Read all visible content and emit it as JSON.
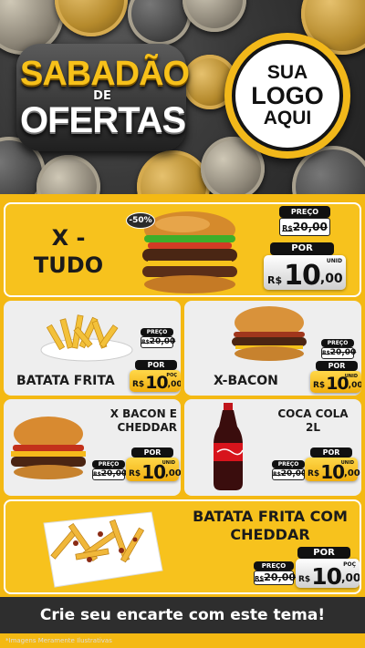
{
  "header": {
    "title_line1": "SABADÃO",
    "title_line2": "DE",
    "title_line3": "OFERTAS",
    "logo_line1": "SUA",
    "logo_line2": "LOGO",
    "logo_line3": "AQUI"
  },
  "featured": {
    "name_line1": "X -",
    "name_line2": "TUDO",
    "discount": "-50%",
    "old_label": "PREÇO",
    "old_currency": "R$",
    "old_price": "20,00",
    "por_label": "POR",
    "currency": "R$",
    "price_int": "10",
    "price_dec": ",00",
    "unit": "UNID"
  },
  "products": [
    {
      "name": "BATATA FRITA",
      "old_label": "PREÇO",
      "old_currency": "R$",
      "old_price": "20,00",
      "por_label": "POR",
      "currency": "R$",
      "price_int": "10",
      "price_dec": ",00",
      "unit": "POÇ"
    },
    {
      "name": "X-BACON",
      "old_label": "PREÇO",
      "old_currency": "R$",
      "old_price": "20,00",
      "por_label": "POR",
      "currency": "R$",
      "price_int": "10",
      "price_dec": ",00",
      "unit": "UNID"
    },
    {
      "name_line1": "X BACON E",
      "name_line2": "CHEDDAR",
      "old_label": "PREÇO",
      "old_currency": "R$",
      "old_price": "20,00",
      "por_label": "POR",
      "currency": "R$",
      "price_int": "10",
      "price_dec": ",00",
      "unit": "UNID"
    },
    {
      "name_line1": "COCA COLA",
      "name_line2": "2L",
      "old_label": "PREÇO",
      "old_currency": "R$",
      "old_price": "20,00",
      "por_label": "POR",
      "currency": "R$",
      "price_int": "10",
      "price_dec": ",00",
      "unit": "UNID"
    },
    {
      "name_line1": "BATATA FRITA COM",
      "name_line2": "CHEDDAR",
      "old_label": "PREÇO",
      "old_currency": "R$",
      "old_price": "20,00",
      "por_label": "POR",
      "currency": "R$",
      "price_int": "10",
      "price_dec": ",00",
      "unit": "POÇ"
    }
  ],
  "footer": {
    "cta": "Crie seu encarte com este tema!",
    "note": "*Imagens Meramente Ilustrativas"
  },
  "colors": {
    "accent": "#f4b913",
    "dark": "#111111",
    "card_light": "#eeeeee"
  }
}
